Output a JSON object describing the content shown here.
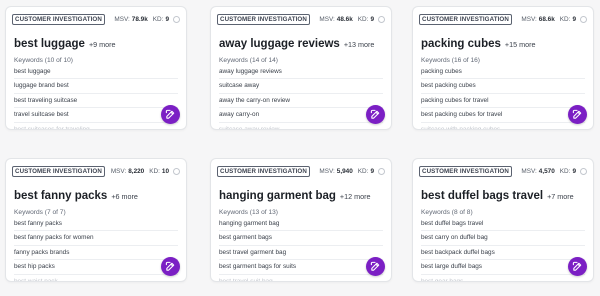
{
  "colors": {
    "accent": "#7b1fc4",
    "background": "#f6f6f7",
    "card": "#ffffff"
  },
  "icons": {
    "edit": "edit-pencil-icon",
    "info": "info-icon"
  },
  "cards": [
    {
      "badge": "CUSTOMER INVESTIGATION",
      "msv_label": "MSV:",
      "msv": "78.9k",
      "kd_label": "KD:",
      "kd": "9",
      "title": "best luggage",
      "more": "+9 more",
      "keywords_header": "Keywords (10 of 10)",
      "keywords": [
        "best luggage",
        "luggage brand best",
        "best traveling suitcase",
        "travel suitcase best",
        "best suitcases for traveling"
      ]
    },
    {
      "badge": "CUSTOMER INVESTIGATION",
      "msv_label": "MSV:",
      "msv": "48.6k",
      "kd_label": "KD:",
      "kd": "9",
      "title": "away luggage reviews",
      "more": "+13 more",
      "keywords_header": "Keywords (14 of 14)",
      "keywords": [
        "away luggage reviews",
        "suitcase away",
        "away the carry-on review",
        "away carry-on",
        "suitcase away review"
      ]
    },
    {
      "badge": "CUSTOMER INVESTIGATION",
      "msv_label": "MSV:",
      "msv": "68.6k",
      "kd_label": "KD:",
      "kd": "9",
      "title": "packing cubes",
      "more": "+15 more",
      "keywords_header": "Keywords (16 of 16)",
      "keywords": [
        "packing cubes",
        "best packing cubes",
        "packing cubes for travel",
        "best packing cubes for travel",
        "suitcase with packing cubes"
      ]
    },
    {
      "badge": "CUSTOMER INVESTIGATION",
      "msv_label": "MSV:",
      "msv": "8,220",
      "kd_label": "KD:",
      "kd": "10",
      "title": "best fanny packs",
      "more": "+6 more",
      "keywords_header": "Keywords (7 of 7)",
      "keywords": [
        "best fanny packs",
        "best fanny packs for women",
        "fanny packs brands",
        "best hip packs",
        "best waist pack"
      ]
    },
    {
      "badge": "CUSTOMER INVESTIGATION",
      "msv_label": "MSV:",
      "msv": "5,940",
      "kd_label": "KD:",
      "kd": "9",
      "title": "hanging garment bag",
      "more": "+12 more",
      "keywords_header": "Keywords (13 of 13)",
      "keywords": [
        "hanging garment bag",
        "best garment bags",
        "best travel garment bag",
        "best garment bags for suits",
        "best travel suit bag"
      ]
    },
    {
      "badge": "CUSTOMER INVESTIGATION",
      "msv_label": "MSV:",
      "msv": "4,570",
      "kd_label": "KD:",
      "kd": "9",
      "title": "best duffel bags travel",
      "more": "+7 more",
      "keywords_header": "Keywords (8 of 8)",
      "keywords": [
        "best duffel bags travel",
        "best carry on duffel bag",
        "best backpack duffel bags",
        "best large duffel bags",
        "best gear bags"
      ]
    }
  ]
}
